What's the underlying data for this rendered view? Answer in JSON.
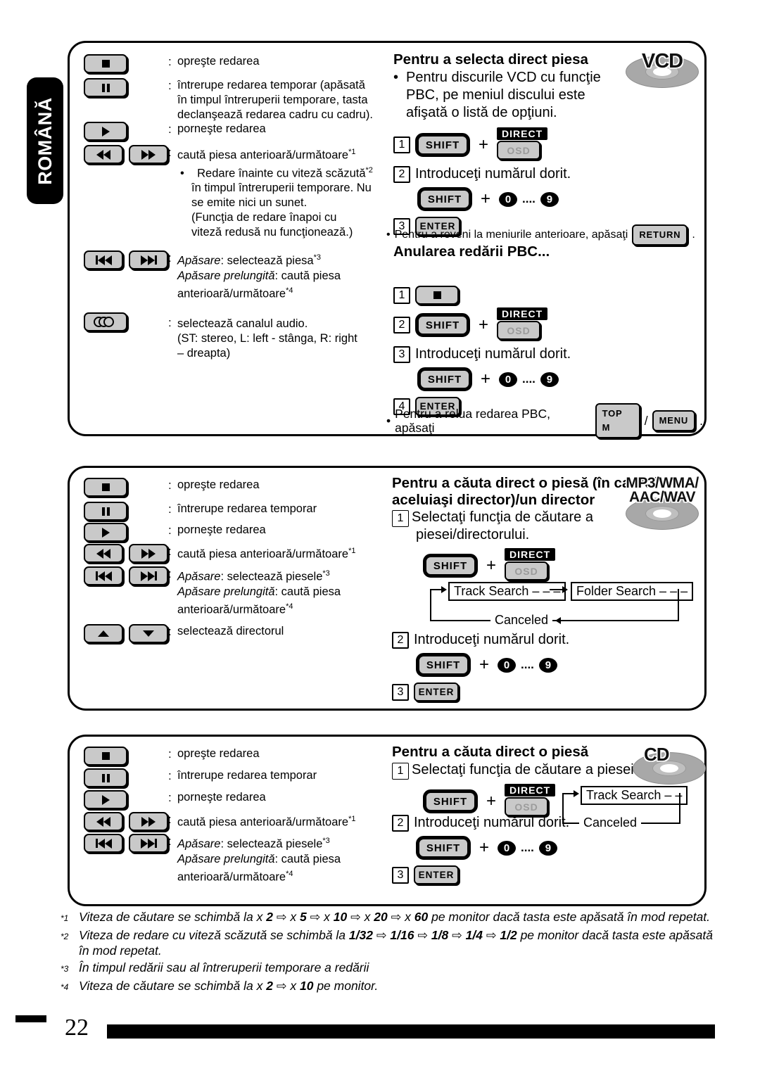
{
  "language_tab": "ROMÂNĂ",
  "page_number": "22",
  "colors": {
    "key_face": "#c9c9c9",
    "ink": "#000000",
    "disc": "#a8a8a8"
  },
  "panels": [
    {
      "id": "vcd",
      "disc_logo": "VCD",
      "controls": [
        {
          "keys": [
            "stop-icon"
          ],
          "colon": ":",
          "lines": [
            {
              "text": "opreşte redarea"
            }
          ]
        },
        {
          "keys": [
            "pause-icon"
          ],
          "colon": ":",
          "lines": [
            {
              "text": "întrerupe redarea temporar (apăsată"
            },
            {
              "text": "în timpul întreruperii temporare, tasta"
            },
            {
              "text": "declanşează redarea cadru cu cadru)."
            }
          ]
        },
        {
          "keys": [
            "play-icon"
          ],
          "colon": ":",
          "lines": [
            {
              "text": "porneşte redarea"
            }
          ]
        },
        {
          "keys": [
            "rewind-icon",
            "fast-forward-icon"
          ],
          "colon": ":",
          "lines": [
            {
              "text": "caută piesa anterioară/următoare",
              "sup": "*1"
            },
            {
              "bullet": true,
              "text": "Redare înainte cu viteză scăzută",
              "sup": "*2"
            },
            {
              "indent": true,
              "text": "în timpul întreruperii temporare. Nu"
            },
            {
              "indent": true,
              "text": "se emite nici un sunet."
            },
            {
              "indent": true,
              "text": "(Funcţia de redare înapoi cu"
            },
            {
              "indent": true,
              "text": "viteză redusă nu funcţionează.)"
            }
          ]
        },
        {
          "keys": [
            "previous-track-icon",
            "next-track-icon"
          ],
          "colon": ":",
          "lines": [
            {
              "italic_lead": "Apăsare",
              "text": ": selectează piesa",
              "sup": "*3"
            },
            {
              "italic_lead": "Apăsare prelungită",
              "text": ": caută piesa"
            },
            {
              "text": "anterioară/următoare",
              "sup": "*4"
            }
          ]
        },
        {
          "keys": [
            "audio-channel-icon"
          ],
          "colon": ":",
          "lines": [
            {
              "text": "selectează canalul audio."
            },
            {
              "text": "(ST: stereo, L: left - stânga, R: right"
            },
            {
              "text": "– dreapta)"
            }
          ]
        }
      ],
      "sections": [
        {
          "title": "Pentru a selecta direct piesa",
          "bullets": [
            "Pentru discurile VCD cu funcţie",
            "PBC, pe meniul discului este",
            "afişată o listă de opţiuni."
          ],
          "steps": [
            {
              "num": "1",
              "type": "shift_combo",
              "shift": "SHIFT",
              "plus": "+",
              "direct": "DIRECT",
              "osd": "OSD"
            },
            {
              "num": "2",
              "type": "text",
              "text": "Introduceţi numărul dorit."
            },
            {
              "type": "shift_digits",
              "shift": "SHIFT",
              "plus": "+",
              "first": "0",
              "dots": "....",
              "last": "9"
            },
            {
              "num": "3",
              "type": "enter",
              "enter": "ENTER"
            }
          ],
          "note": {
            "bullet": "•",
            "before": "Pentru a reveni la meniurile anterioare, apăsaţi",
            "key": "RETURN",
            "after": "."
          }
        },
        {
          "title": "Anularea redării PBC...",
          "steps": [
            {
              "num": "1",
              "type": "stopkey"
            },
            {
              "num": "2",
              "type": "shift_combo",
              "shift": "SHIFT",
              "plus": "+",
              "direct": "DIRECT",
              "osd": "OSD"
            },
            {
              "num": "3",
              "type": "text",
              "text": "Introduceţi numărul dorit."
            },
            {
              "type": "shift_digits",
              "shift": "SHIFT",
              "plus": "+",
              "first": "0",
              "dots": "....",
              "last": "9"
            },
            {
              "num": "4",
              "type": "enter",
              "enter": "ENTER"
            }
          ],
          "note2": {
            "bullet": "•",
            "before": "Pentru a relua redarea PBC, apăsaţi",
            "key1": "TOP M",
            "sep": "/",
            "key2": "MENU",
            "after": "."
          }
        }
      ]
    },
    {
      "id": "mp3",
      "disc_logo_lines": [
        "MP3/WMA/",
        "AAC/WAV"
      ],
      "controls": [
        {
          "keys": [
            "stop-icon"
          ],
          "colon": ":",
          "lines": [
            {
              "text": "opreşte redarea"
            }
          ]
        },
        {
          "keys": [
            "pause-icon"
          ],
          "colon": ":",
          "lines": [
            {
              "text": "întrerupe redarea temporar"
            }
          ]
        },
        {
          "keys": [
            "play-icon"
          ],
          "colon": ":",
          "lines": [
            {
              "text": "porneşte redarea"
            }
          ]
        },
        {
          "keys": [
            "rewind-icon",
            "fast-forward-icon"
          ],
          "colon": ":",
          "lines": [
            {
              "text": "caută piesa anterioară/următoare",
              "sup": "*1"
            }
          ]
        },
        {
          "keys": [
            "previous-track-icon",
            "next-track-icon"
          ],
          "colon": ":",
          "lines": [
            {
              "italic_lead": "Apăsare",
              "text": ": selectează piesele",
              "sup": "*3"
            },
            {
              "italic_lead": "Apăsare prelungită",
              "text": ": caută piesa"
            },
            {
              "text": "anterioară/următoare",
              "sup": "*4"
            }
          ]
        },
        {
          "keys": [
            "folder-up-icon",
            "folder-down-icon"
          ],
          "colon": ":",
          "lines": [
            {
              "text": "selectează directorul"
            }
          ]
        }
      ],
      "section": {
        "title_lines": [
          "Pentru a căuta direct o piesă (în cadrul",
          "aceluiaşi director)/un director"
        ],
        "step1_num": "1",
        "step1_lines": [
          "Selectaţi funcţia de căutare a",
          "piesei/directorului."
        ],
        "shift": "SHIFT",
        "plus": "+",
        "direct": "DIRECT",
        "osd": "OSD",
        "flow": {
          "box1": "Track Search – – –",
          "box2": "Folder Search – – –",
          "cancel": "Canceled"
        },
        "step2_num": "2",
        "step2_text": "Introduceţi numărul dorit.",
        "digits": {
          "shift": "SHIFT",
          "plus": "+",
          "first": "0",
          "dots": "....",
          "last": "9"
        },
        "step3_num": "3",
        "enter": "ENTER"
      }
    },
    {
      "id": "cd",
      "disc_logo": "CD",
      "controls": [
        {
          "keys": [
            "stop-icon"
          ],
          "colon": ":",
          "lines": [
            {
              "text": "opreşte redarea"
            }
          ]
        },
        {
          "keys": [
            "pause-icon"
          ],
          "colon": ":",
          "lines": [
            {
              "text": "întrerupe redarea temporar"
            }
          ]
        },
        {
          "keys": [
            "play-icon"
          ],
          "colon": ":",
          "lines": [
            {
              "text": "porneşte redarea"
            }
          ]
        },
        {
          "keys": [
            "rewind-icon",
            "fast-forward-icon"
          ],
          "colon": ":",
          "lines": [
            {
              "text": "caută piesa anterioară/următoare",
              "sup": "*1"
            }
          ]
        },
        {
          "keys": [
            "previous-track-icon",
            "next-track-icon"
          ],
          "colon": ":",
          "lines": [
            {
              "italic_lead": "Apăsare",
              "text": ": selectează piesele",
              "sup": "*3"
            },
            {
              "italic_lead": "Apăsare prelungită",
              "text": ": caută piesa"
            },
            {
              "text": "anterioară/următoare",
              "sup": "*4"
            }
          ]
        }
      ],
      "section": {
        "title": "Pentru a căuta direct o piesă",
        "step1_num": "1",
        "step1_text": "Selectaţi funcţia de căutare a piesei.",
        "shift": "SHIFT",
        "plus": "+",
        "direct": "DIRECT",
        "osd": "OSD",
        "flow": {
          "box1": "Track Search – –",
          "cancel": "Canceled"
        },
        "step2_num": "2",
        "step2_text": "Introduceţi numărul dorit.",
        "digits": {
          "shift": "SHIFT",
          "plus": "+",
          "first": "0",
          "dots": "....",
          "last": "9"
        },
        "step3_num": "3",
        "enter": "ENTER"
      }
    }
  ],
  "footnotes": [
    {
      "mark": "*1",
      "html": "Viteza de căutare se schimbă la x <b>2</b> <span class=\"arrowglyph\">⇨</span> x <b>5</b> <span class=\"arrowglyph\">⇨</span> x <b>10</b> <span class=\"arrowglyph\">⇨</span> x <b>20</b> <span class=\"arrowglyph\">⇨</span> x <b>60</b> pe monitor dacă tasta este apăsată în mod repetat."
    },
    {
      "mark": "*2",
      "html": "Viteza de redare cu viteză scăzută se schimbă la <b>1/32</b> <span class=\"arrowglyph\">⇨</span> <b>1/16</b> <span class=\"arrowglyph\">⇨</span> <b>1/8</b> <span class=\"arrowglyph\">⇨</span> <b>1/4</b> <span class=\"arrowglyph\">⇨</span> <b>1/2</b> pe monitor dacă tasta este apăsată în mod repetat."
    },
    {
      "mark": "*3",
      "html": "În timpul redării sau al întreruperii temporare a redării"
    },
    {
      "mark": "*4",
      "html": "Viteza de căutare se schimbă la x <b>2</b> <span class=\"arrowglyph\">⇨</span> x <b>10</b> pe monitor."
    }
  ]
}
